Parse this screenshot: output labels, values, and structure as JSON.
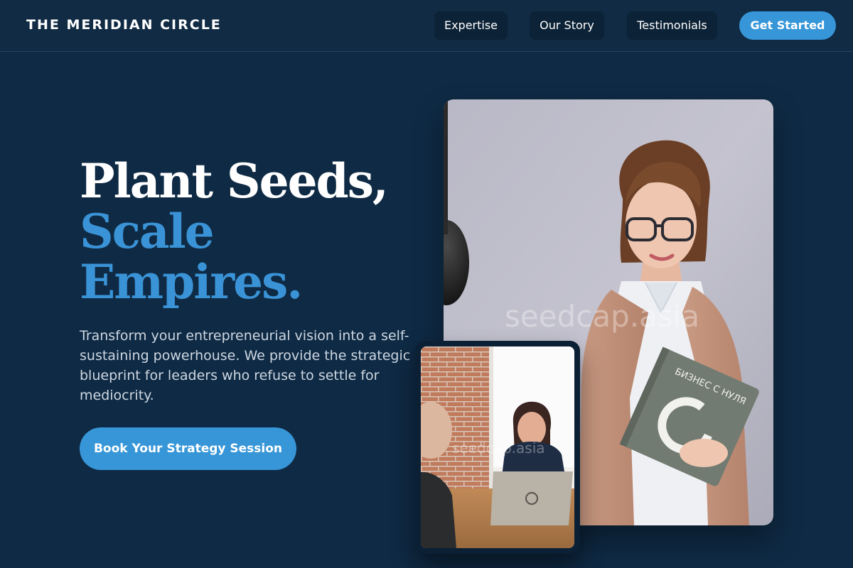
{
  "brand": "THE MERIDIAN CIRCLE",
  "nav": {
    "items": [
      "Expertise",
      "Our Story",
      "Testimonials"
    ],
    "cta": "Get Started"
  },
  "hero": {
    "headline_line1": "Plant Seeds,",
    "headline_line2": "Scale",
    "headline_line3": "Empires.",
    "intro": "Transform your entrepreneurial vision into a self-sustaining powerhouse. We provide the strategic blueprint for leaders who refuse to settle for mediocrity.",
    "cta": "Book Your Strategy Session"
  },
  "photos": {
    "main_watermark": "seedcap.asia",
    "small_watermark": "seedcap.asia",
    "book_title": "БИЗНЕС С НУЛЯ"
  },
  "colors": {
    "background": "#0f2a44",
    "accent": "#3796d8",
    "headline_accent": "#3a93d6",
    "nav_button": "#0c2236"
  }
}
